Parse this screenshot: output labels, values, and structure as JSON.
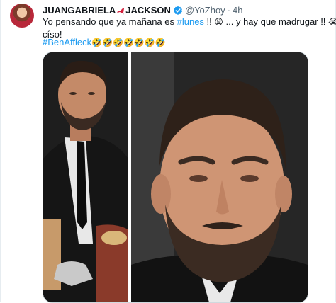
{
  "tweet": {
    "author_name": "JUANGABRIELA",
    "author_name_suffix": "JACKSON",
    "name_emoji": "heels-emoji",
    "handle": "@YoZhoy",
    "separator": "·",
    "time": "4h",
    "text_part1": "Yo pensando que ya mañana es ",
    "text_hashtag1": "#lunes",
    "text_part2": " !! ",
    "text_emoji1": "😩",
    "text_part3": " ... y hay que madrugar !! ",
    "text_emoji2": "😭",
    "text_line2": "císo!",
    "hashtag2": "#BenAffleck",
    "trailing_emojis": "🤣🤣🤣🤣🤣🤣🤣"
  },
  "media": {
    "left_image": "man-in-suit-photo",
    "right_image": "man-closeup-photo"
  },
  "colors": {
    "link": "#1d9bf0",
    "secondary_text": "#536471",
    "verified_badge": "#1d9bf0"
  }
}
